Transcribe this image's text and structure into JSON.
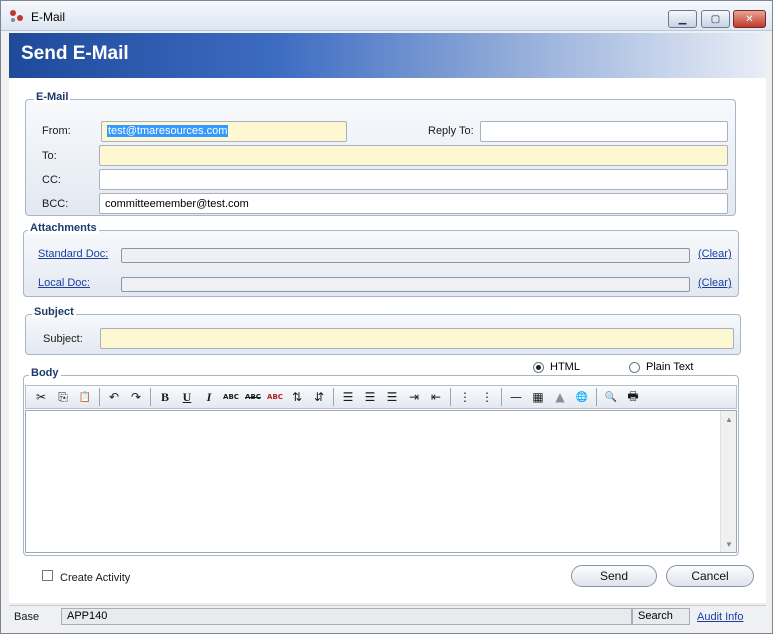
{
  "window": {
    "title": "E-Mail",
    "min_glyph": "▁",
    "max_glyph": "▢",
    "close_glyph": "✕"
  },
  "header": {
    "title": "Send E-Mail"
  },
  "email_group": {
    "legend": "E-Mail",
    "from_label": "From:",
    "from_value": "test@tmaresources.com",
    "reply_to_label": "Reply To:",
    "reply_to_value": "",
    "to_label": "To:",
    "to_value": "",
    "cc_label": "CC:",
    "cc_value": "",
    "bcc_label": "BCC:",
    "bcc_value": "committeemember@test.com"
  },
  "attachments_group": {
    "legend": "Attachments",
    "standard_doc_label": "Standard Doc:",
    "local_doc_label": "Local Doc:",
    "clear_label": "(Clear)"
  },
  "subject_group": {
    "legend": "Subject",
    "subject_label": "Subject:",
    "subject_value": ""
  },
  "body_group": {
    "legend": "Body",
    "format_html": "HTML",
    "format_plain": "Plain Text",
    "selected_format": "HTML",
    "toolbar": {
      "cut": "✂",
      "copy": "⎘",
      "paste": "📋",
      "undo": "↶",
      "redo": "↷",
      "bold": "B",
      "underline": "U",
      "italic": "I",
      "font_small": "ABC",
      "strikethrough": "ABC",
      "font_color": "ABC",
      "sort_asc": "⇅",
      "sort_desc": "⇵",
      "align_left": "☰",
      "align_center": "☰",
      "align_right": "☰",
      "indent": "⇥",
      "outdent": "⇤",
      "bulleted_list": "⋮",
      "numbered_list": "⋮",
      "horizontal_rule": "—",
      "table": "▦",
      "image": "▲",
      "hyperlink": "🌐",
      "find": "🔍",
      "print": "🖶"
    },
    "scroll_up": "▲",
    "scroll_down": "▼"
  },
  "create_activity_label": "Create Activity",
  "buttons": {
    "send": "Send",
    "cancel": "Cancel"
  },
  "statusbar": {
    "base": "Base",
    "app_code": "APP140",
    "search": "Search",
    "audit_info": "Audit Info"
  }
}
